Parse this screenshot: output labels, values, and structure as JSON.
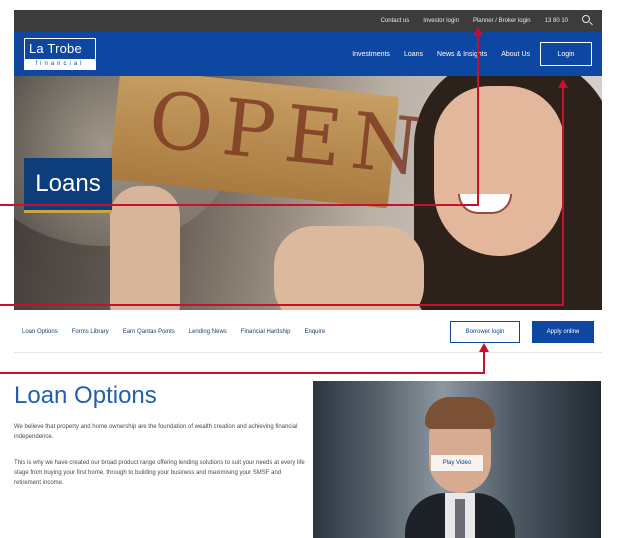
{
  "utility_bar": {
    "links": [
      "Contact us",
      "Investor login",
      "Planner / Broker login",
      "13 80 10"
    ]
  },
  "nav": {
    "logo_name": "La Trobe",
    "logo_sub": "financial",
    "items": [
      "Investments",
      "Loans",
      "News & Insights",
      "About Us"
    ],
    "login": "Login"
  },
  "hero": {
    "sign_text": "OPEN",
    "title": "Loans"
  },
  "subnav": {
    "items": [
      "Loan Options",
      "Forms Library",
      "Earn Qantas Points",
      "Lending News",
      "Financial Hardship",
      "Enquire"
    ],
    "borrower_login": "Borrower login",
    "apply_online": "Apply online"
  },
  "content": {
    "title": "Loan Options",
    "paragraph1": "We believe that property and home ownership are the foundation of wealth creation and achieving financial independence.",
    "paragraph2": "This is why we have created our broad product range offering lending solutions to suit your needs at every life stage from buying your first home, through to building your business and maximising your SMSF and retirement income.",
    "video_play": "Play Video"
  },
  "colors": {
    "brand_blue": "#0d47a1",
    "annotation_red": "#c8102e",
    "accent_gold": "#c9a544"
  }
}
